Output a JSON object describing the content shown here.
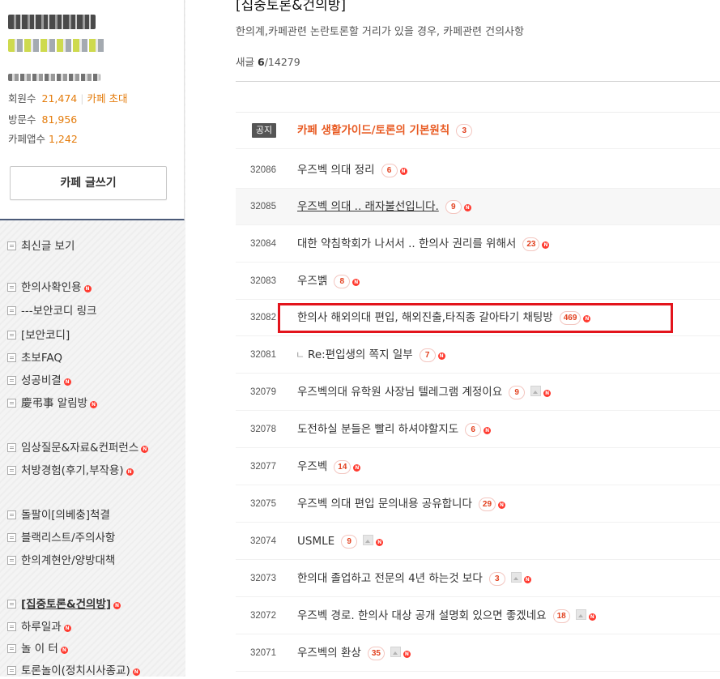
{
  "cafe": {
    "members_label": "회원수",
    "members_value": "21,474",
    "invite_label": "카페 초대",
    "visits_label": "방문수",
    "visits_value": "81,956",
    "app_label": "카페앱수",
    "app_value": "1,242",
    "write_button": "카페 글쓰기",
    "separator": "|"
  },
  "sidebar": {
    "items": [
      {
        "label": "최신글 보기"
      },
      {
        "label": "한의사확인용"
      },
      {
        "label": "---보안코디 링크"
      },
      {
        "label": "[보안코디]"
      },
      {
        "label": "초보FAQ"
      },
      {
        "label": "성공비결"
      },
      {
        "label": "慶弔事 알림방"
      },
      {
        "label": "임상질문&자료&컨퍼런스"
      },
      {
        "label": "처방경험(후기,부작용)"
      },
      {
        "label": "돌팔이[의베충]척결"
      },
      {
        "label": "블랙리스트/주의사항"
      },
      {
        "label": "한의계현안/양방대책"
      },
      {
        "label": "[집중토론&건의방]"
      },
      {
        "label": "하루일과"
      },
      {
        "label": "놀 이 터"
      },
      {
        "label": "토론놀이(정치시사종교)"
      }
    ]
  },
  "board": {
    "title": "[집중토론&건의방]",
    "description": "한의계,카페관련 논란토론할 거리가 있을 경우, 카페관련 건의사항",
    "new_label": "새글",
    "new_count": "6",
    "total_count": "/14279",
    "notice_badge": "공지",
    "new_icon": "N",
    "reply_mark": "ㄴ",
    "rows": [
      {
        "no": "",
        "subject": "카페 생활가이드/토론의 기본원칙",
        "comments": "3"
      },
      {
        "no": "32086",
        "subject": "우즈벡 의대 정리",
        "comments": "6"
      },
      {
        "no": "32085",
        "subject": "우즈벡 의대 .. 래자불선입니다.",
        "comments": "9"
      },
      {
        "no": "32084",
        "subject": "대한 약침학회가 나서서 .. 한의사 권리를 위해서",
        "comments": "23"
      },
      {
        "no": "32083",
        "subject": "우즈벩",
        "comments": "8"
      },
      {
        "no": "32082",
        "subject": "한의사 해외의대 편입, 해외진출,타직종 갈아타기 채팅방",
        "comments": "469"
      },
      {
        "no": "32081",
        "subject": "Re:편입생의 쪽지 일부",
        "comments": "7"
      },
      {
        "no": "32079",
        "subject": "우즈벡의대 유학원 사장님 텔레그램 계정이요",
        "comments": "9"
      },
      {
        "no": "32078",
        "subject": "도전하실 분들은 빨리 하셔야할지도",
        "comments": "6"
      },
      {
        "no": "32077",
        "subject": "우즈벡",
        "comments": "14"
      },
      {
        "no": "32075",
        "subject": "우즈벡 의대 편입 문의내용 공유합니다",
        "comments": "29"
      },
      {
        "no": "32074",
        "subject": "USMLE",
        "comments": "9"
      },
      {
        "no": "32073",
        "subject": "한의대 졸업하고 전문의 4년 하는것 보다",
        "comments": "3"
      },
      {
        "no": "32072",
        "subject": "우즈벡 경로. 한의사 대상 공개 설명회 있으면 좋겠네요",
        "comments": "18"
      },
      {
        "no": "32071",
        "subject": "우즈벡의 환상",
        "comments": "35"
      }
    ]
  }
}
